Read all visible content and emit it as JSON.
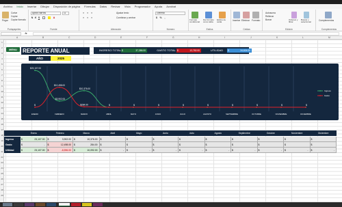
{
  "menubar": {
    "items": [
      "Archivo",
      "Inicio",
      "Insertar",
      "Dibujar",
      "Disposición de página",
      "Fórmulas",
      "Datos",
      "Revisar",
      "Vista",
      "Programador",
      "Ayuda",
      "Acrobat"
    ],
    "active": "Inicio"
  },
  "ribbon": {
    "portapapeles": {
      "name": "Portapapeles",
      "paste": "Pegar",
      "cut": "Cortar",
      "copy": "Copiar",
      "format": "Copiar formato"
    },
    "fuente": {
      "name": "Fuente",
      "font": "Aptos Narrow",
      "size": "11"
    },
    "alineacion": {
      "name": "Alineación",
      "wrap": "Ajustar texto",
      "merge": "Combinar y centrar"
    },
    "numero": {
      "name": "Número",
      "format": "General"
    },
    "estilos": {
      "name": "Estilos",
      "cond": "Formato condicional",
      "table": "Dar formato como tabla",
      "cell": "Estilos de celda"
    },
    "celdas": {
      "name": "Celdas",
      "insert": "Insertar",
      "delete": "Eliminar",
      "format": "Formato"
    },
    "edicion": {
      "name": "Edición",
      "autosum": "Autosuma",
      "fill": "Rellenar",
      "clear": "Borrar",
      "sort": "Ordenar y filtrar",
      "find": "Buscar y seleccionar"
    },
    "complementos": {
      "name": "Complementos",
      "addins": "Complementos"
    }
  },
  "header": {
    "menu_button": "MENU",
    "title": "REPORTE ANUAL",
    "year_label": "AÑO",
    "year_value": "2025"
  },
  "kpis": {
    "ingreso_label": "INGRESO TOTAL",
    "ingreso_currency": "$",
    "ingreso_value": "37,386.00",
    "gasto_label": "GASTO TOTAL",
    "gasto_currency": "$",
    "gasto_value": "12,782.00",
    "utilidad_label": "UTILIDAD",
    "utilidad_currency": "$",
    "utilidad_value": "24,604.00"
  },
  "colors": {
    "navy": "#14273e",
    "ingreso_green": "#1f6b3a",
    "gasto_red": "#c0161d",
    "utilidad_blue": "#3a8ed6",
    "year_yellow": "#fff43a",
    "line_ingreso": "#3aa86b",
    "line_gasto": "#e0212b"
  },
  "chart_data": {
    "type": "line",
    "categories": [
      "ENERO",
      "FEBRERO",
      "MARZO",
      "ABRIL",
      "MAYO",
      "JUNIO",
      "JULIO",
      "AGOSTO",
      "SEPTIEMBRE",
      "OCTUBRE",
      "NOVIEMBRE",
      "DICIEMBRE"
    ],
    "series": [
      {
        "name": "Ingreso",
        "values": [
          23107,
          3902,
          10376,
          0,
          0,
          0,
          0,
          0,
          0,
          0,
          0,
          0
        ],
        "labels": [
          "$23,107.00",
          "$3,902.00",
          "$10,376.00",
          "$",
          "$",
          "$",
          "$",
          "$",
          "$",
          "$",
          "$",
          "$"
        ]
      },
      {
        "name": "Gasto",
        "values": [
          0,
          12498,
          284,
          0,
          0,
          0,
          0,
          0,
          0,
          0,
          0,
          0
        ],
        "labels": [
          "$",
          "$12,498.00",
          "$284.00",
          "",
          "",
          "",
          "",
          "",
          "",
          "",
          "",
          ""
        ]
      }
    ],
    "legend": "right",
    "ylim": [
      0,
      24000
    ]
  },
  "table": {
    "months": [
      "Enero",
      "Febrero",
      "Marzo",
      "Abril",
      "Mayo",
      "Junio",
      "Julio",
      "Agosto",
      "Septiembre",
      "Octubre",
      "Noviembre",
      "Diciembre"
    ],
    "rows": [
      {
        "label": "Ingreso",
        "cells": [
          "23,107.00",
          "3,902.00",
          "10,376.00",
          "",
          "",
          "",
          "",
          "",
          "",
          "",
          "",
          ""
        ]
      },
      {
        "label": "Gasto",
        "cells": [
          "-",
          "12,498.00",
          "284.00",
          "",
          "",
          "",
          "",
          "",
          "",
          "",
          "",
          ""
        ]
      },
      {
        "label": "Utilidad",
        "cells": [
          "23,107.00",
          "-8,596.00",
          "10,092.00",
          "-",
          "-",
          "-",
          "-",
          "-",
          "-",
          "-",
          "-",
          "-"
        ]
      }
    ],
    "currency": "$"
  },
  "columns": [
    "A",
    "B",
    "C",
    "D",
    "E",
    "F",
    "G",
    "H",
    "I",
    "J",
    "K",
    "L",
    "M"
  ],
  "rows": [
    "1",
    "2",
    "3",
    "4",
    "5",
    "6",
    "7",
    "8",
    "9",
    "10",
    "11",
    "12",
    "13",
    "14",
    "15",
    "16",
    "17",
    "18",
    "19",
    "20",
    "21",
    "22",
    "23",
    "24",
    "25",
    "26",
    "27",
    "28",
    "29"
  ]
}
